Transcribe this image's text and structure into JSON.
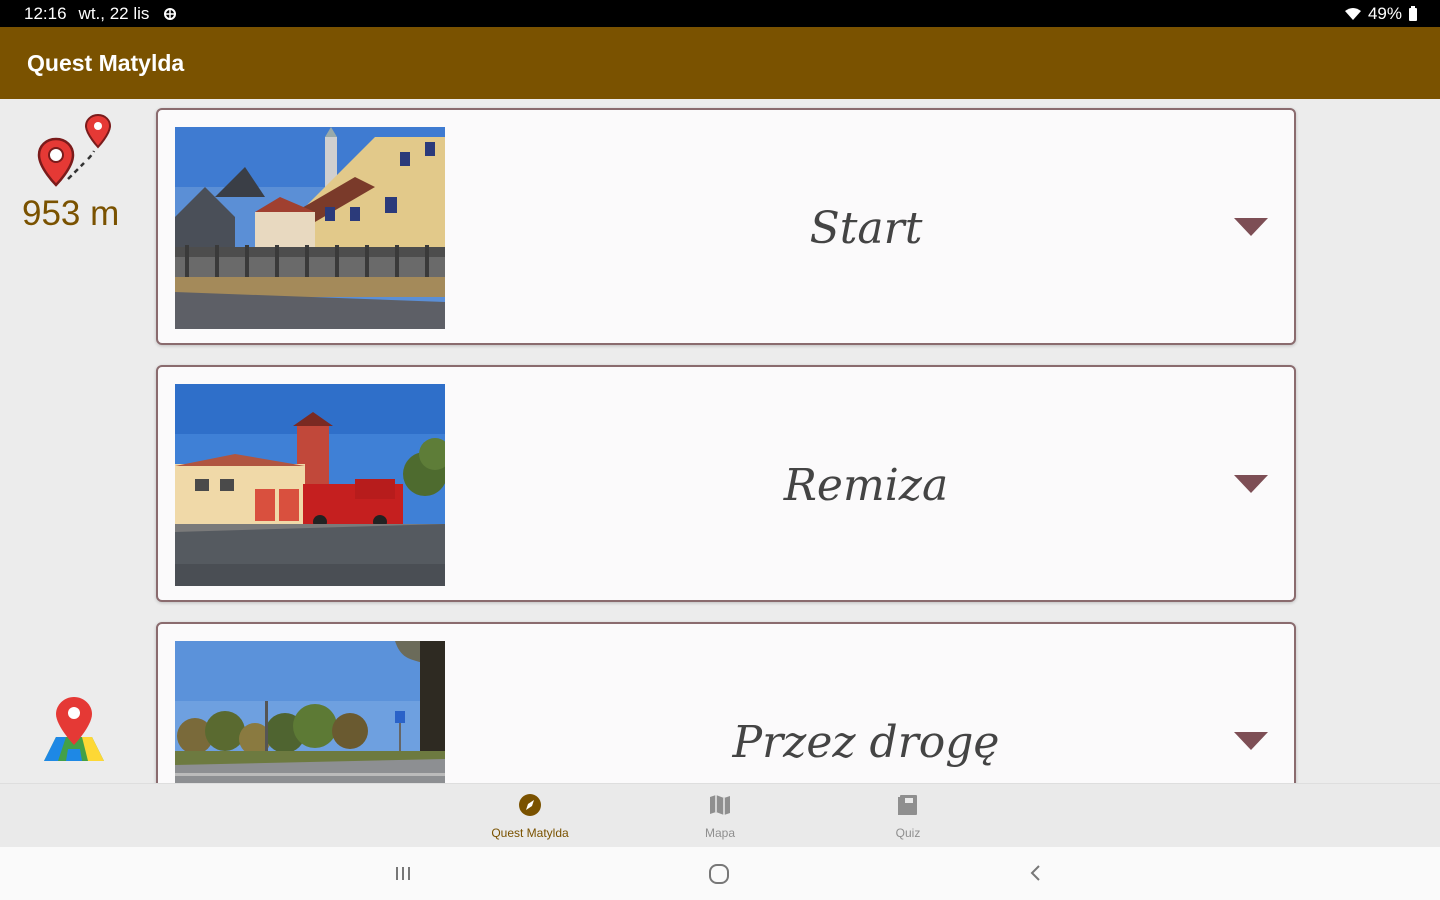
{
  "status_bar": {
    "time": "12:16",
    "date": "wt., 22 lis",
    "battery": "49%"
  },
  "app_bar": {
    "title": "Quest Matylda"
  },
  "side_panel": {
    "distance": "953 m",
    "route_icon": "route-pins-icon",
    "map_icon": "map-pin-icon"
  },
  "cards": [
    {
      "title": "Start",
      "image": "street-buildings-photo"
    },
    {
      "title": "Remiza",
      "image": "fire-station-photo"
    },
    {
      "title": "Przez drogę",
      "image": "road-trees-photo"
    }
  ],
  "bottom_nav": {
    "items": [
      {
        "label": "Quest Matylda",
        "icon": "compass-icon",
        "active": true
      },
      {
        "label": "Mapa",
        "icon": "map-icon",
        "active": false
      },
      {
        "label": "Quiz",
        "icon": "book-icon",
        "active": false
      }
    ]
  },
  "colors": {
    "app_bar": "#7a5200",
    "accent_text": "#7a5200",
    "card_border": "#8a6b6e",
    "chevron": "#7d4e55"
  }
}
